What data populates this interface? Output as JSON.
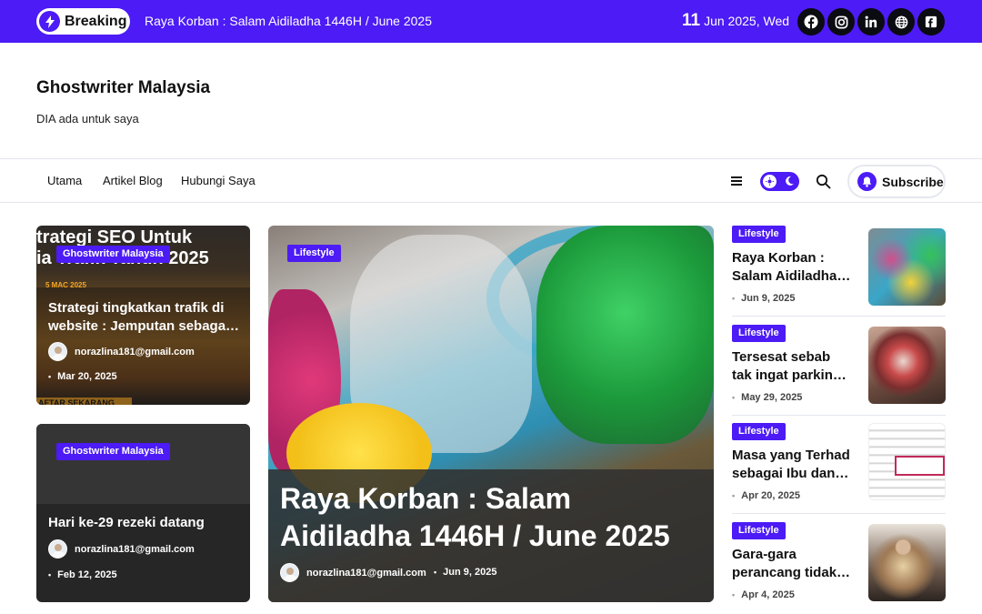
{
  "topbar": {
    "breaking_label": "Breaking",
    "ticker": "Raya Korban : Salam Aidiladha 1446H / June 2025",
    "date_day": "11",
    "date_rest": "Jun 2025, Wed",
    "socials": [
      "facebook-icon",
      "instagram-icon",
      "linkedin-icon",
      "globe-icon",
      "flickr-icon"
    ]
  },
  "header": {
    "site_title": "Ghostwriter Malaysia",
    "tagline": "DIA ada untuk saya"
  },
  "nav": {
    "items": [
      "Utama",
      "Artikel Blog",
      "Hubungi Saya"
    ],
    "subscribe_label": "Subscribe"
  },
  "left_cards": [
    {
      "badge": "Ghostwriter Malaysia",
      "image_text_line1": "trategi SEO Untuk",
      "image_text_line2": "ia Trafik Tahun 2025",
      "image_small": "5 MAC 2025",
      "image_strip": "AFTAR SEKARANG",
      "title_line1": "Strategi tingkatkan trafik di",
      "title_line2": "website : Jemputan sebaga…",
      "author": "norazlina181@gmail.com",
      "date": "Mar 20, 2025"
    },
    {
      "badge": "Ghostwriter Malaysia",
      "title": "Hari ke-29 rezeki datang",
      "author": "norazlina181@gmail.com",
      "date": "Feb 12, 2025"
    }
  ],
  "featured": {
    "badge": "Lifestyle",
    "title_line1": "Raya Korban : Salam",
    "title_line2": "Aidiladha 1446H / June 2025",
    "author": "norazlina181@gmail.com",
    "date": "Jun 9, 2025"
  },
  "right_list": [
    {
      "badge": "Lifestyle",
      "title_line1": "Raya Korban :",
      "title_line2": "Salam Aidiladha…",
      "date": "Jun 9, 2025"
    },
    {
      "badge": "Lifestyle",
      "title_line1": "Tersesat sebab",
      "title_line2": "tak ingat parkin…",
      "date": "May 29, 2025"
    },
    {
      "badge": "Lifestyle",
      "title_line1": "Masa yang Terhad",
      "title_line2": "sebagai Ibu dan…",
      "date": "Apr 20, 2025"
    },
    {
      "badge": "Lifestyle",
      "title_line1": "Gara-gara",
      "title_line2": "perancang tidak…",
      "date": "Apr 4, 2025"
    }
  ],
  "colors": {
    "accent": "#4c1bf5",
    "social_bg": "#0b0b12",
    "text": "#111111"
  }
}
